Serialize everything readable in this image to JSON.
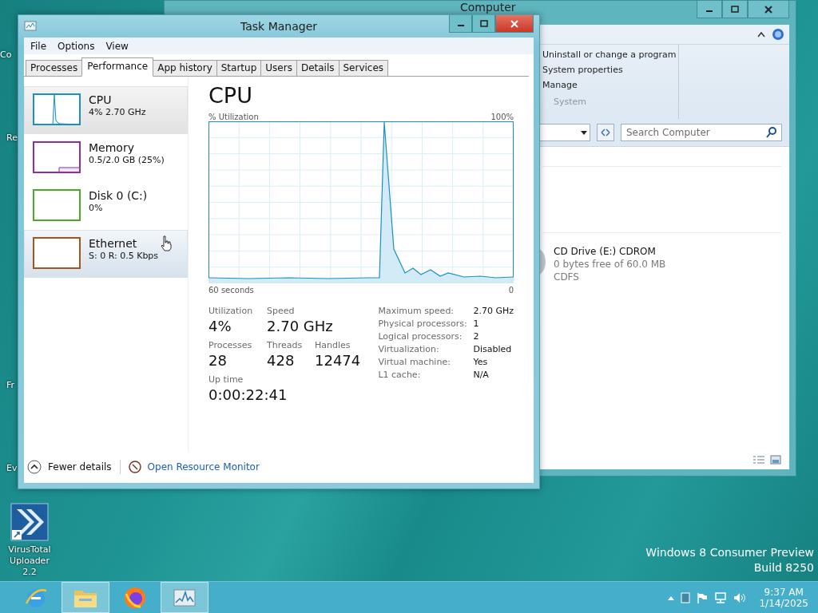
{
  "desktop": {
    "icons": [
      {
        "label": "Co"
      },
      {
        "label": "Re"
      },
      {
        "label": "Fr"
      },
      {
        "label": "Ev"
      }
    ],
    "shortcut": {
      "label": "VirusTotal Uploader 2.2"
    },
    "os_version": [
      "Windows 8 Consumer Preview",
      "Build 8250"
    ]
  },
  "explorer": {
    "title": "Computer",
    "ribbon_links": [
      "Uninstall or change a program",
      "System properties",
      "Manage"
    ],
    "ribbon_group": "System",
    "search": {
      "placeholder": "Search Computer"
    },
    "drive": {
      "name": "CD Drive (E:) CDROM",
      "free": "0 bytes free of 60.0 MB",
      "file_system": "CDFS"
    }
  },
  "task_manager": {
    "title": "Task Manager",
    "menu": [
      "File",
      "Options",
      "View"
    ],
    "tabs": [
      {
        "label": "Processes",
        "selected": false
      },
      {
        "label": "Performance",
        "selected": true
      },
      {
        "label": "App history",
        "selected": false
      },
      {
        "label": "Startup",
        "selected": false
      },
      {
        "label": "Users",
        "selected": false
      },
      {
        "label": "Details",
        "selected": false
      },
      {
        "label": "Services",
        "selected": false
      }
    ],
    "resources": [
      {
        "kind": "cpu",
        "name": "CPU",
        "detail": "4% 2.70 GHz",
        "color": "#1c8fc4",
        "selected": true,
        "hovered": false
      },
      {
        "kind": "memory",
        "name": "Memory",
        "detail": "0.5/2.0 GB (25%)",
        "color": "#8b2fa8",
        "selected": false,
        "hovered": false
      },
      {
        "kind": "disk",
        "name": "Disk 0 (C:)",
        "detail": "0%",
        "color": "#4ca82b",
        "selected": false,
        "hovered": false
      },
      {
        "kind": "network",
        "name": "Ethernet",
        "detail": "S: 0 R: 0.5 Kbps",
        "color": "#a7541b",
        "selected": false,
        "hovered": true
      }
    ],
    "heading": "CPU",
    "chart": {
      "ylabel": "% Utilization",
      "ymax": "100%",
      "xstart": "60 seconds",
      "xend": "0"
    },
    "stats": [
      {
        "label": "Utilization",
        "value": "4%"
      },
      {
        "label": "Speed",
        "value": "2.70 GHz"
      },
      {
        "label": "Processes",
        "value": "28"
      },
      {
        "label": "Threads",
        "value": "428"
      },
      {
        "label": "Handles",
        "value": "12474"
      },
      {
        "label": "Up time",
        "value": "0:00:22:41"
      }
    ],
    "specs": [
      {
        "label": "Maximum speed:",
        "value": "2.70 GHz"
      },
      {
        "label": "Physical processors:",
        "value": "1"
      },
      {
        "label": "Logical processors:",
        "value": "2"
      },
      {
        "label": "Virtualization:",
        "value": "Disabled"
      },
      {
        "label": "Virtual machine:",
        "value": "Yes"
      },
      {
        "label": "L1 cache:",
        "value": "N/A"
      }
    ],
    "footer": {
      "fewer": "Fewer details",
      "monitor": "Open Resource Monitor"
    }
  },
  "taskbar": {
    "apps": [
      {
        "kind": "browser-e",
        "active": false
      },
      {
        "kind": "folder",
        "active": true
      },
      {
        "kind": "browser-fox",
        "active": false
      },
      {
        "kind": "monitor",
        "active": true
      }
    ],
    "time": "9:37 AM",
    "date": "1/14/2025"
  }
}
